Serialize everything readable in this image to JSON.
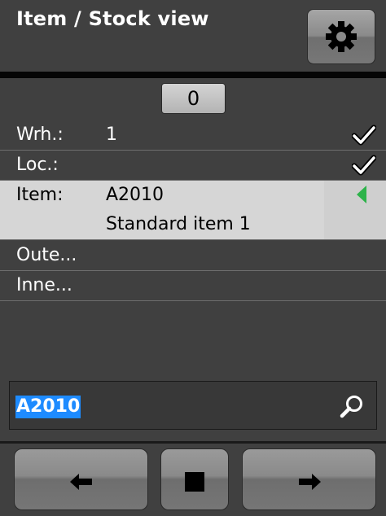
{
  "header": {
    "title": "Item / Stock view"
  },
  "counter": {
    "value": "0"
  },
  "rows": [
    {
      "label": "Wrh.:",
      "value": "1",
      "status": "checked"
    },
    {
      "label": "Loc.:",
      "value": "",
      "status": "checked"
    },
    {
      "label": "Item:",
      "value": "A2010",
      "value2": "Standard item 1",
      "status": "selected"
    },
    {
      "label": "Oute...",
      "value": ""
    },
    {
      "label": "Inne...",
      "value": ""
    }
  ],
  "input": {
    "value": "A2010"
  },
  "colors": {
    "selection": "#1e8bff",
    "pointer": "#2db34a",
    "background": "#404040"
  },
  "icons": {
    "settings": "gear-icon",
    "check": "checkmark-icon",
    "pointer": "triangle-left-icon",
    "search": "search-icon",
    "back": "arrow-left-icon",
    "stop": "stop-icon",
    "forward": "arrow-right-icon"
  }
}
